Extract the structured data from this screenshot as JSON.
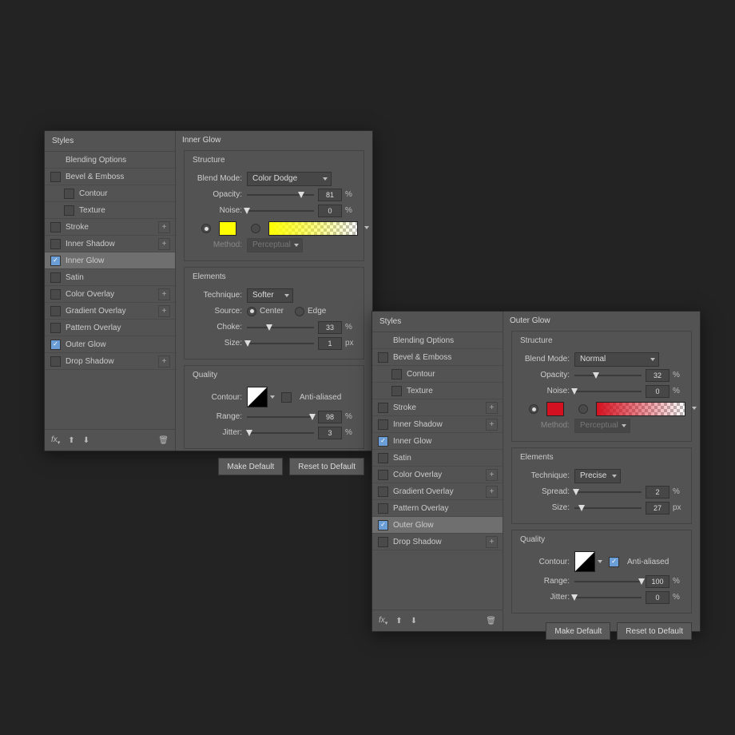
{
  "labels": {
    "styles": "Styles",
    "blending_options": "Blending Options",
    "anti_aliased": "Anti-aliased",
    "make_default": "Make Default",
    "reset_default": "Reset to Default",
    "blend_mode": "Blend Mode:",
    "opacity": "Opacity:",
    "noise": "Noise:",
    "method": "Method:",
    "technique": "Technique:",
    "source": "Source:",
    "center": "Center",
    "edge": "Edge",
    "choke": "Choke:",
    "spread": "Spread:",
    "size": "Size:",
    "contour": "Contour:",
    "range": "Range:",
    "jitter": "Jitter:",
    "structure": "Structure",
    "elements": "Elements",
    "quality": "Quality",
    "pct": "%",
    "px": "px",
    "fx": "fx"
  },
  "style_items": [
    {
      "label": "Bevel & Emboss",
      "plus": false,
      "indent": false,
      "chk": false
    },
    {
      "label": "Contour",
      "plus": false,
      "indent": true,
      "chk": false
    },
    {
      "label": "Texture",
      "plus": false,
      "indent": true,
      "chk": false
    },
    {
      "label": "Stroke",
      "plus": true,
      "indent": false,
      "chk": false
    },
    {
      "label": "Inner Shadow",
      "plus": true,
      "indent": false,
      "chk": false
    },
    {
      "label": "Inner Glow",
      "plus": false,
      "indent": false,
      "chk": true
    },
    {
      "label": "Satin",
      "plus": false,
      "indent": false,
      "chk": false
    },
    {
      "label": "Color Overlay",
      "plus": true,
      "indent": false,
      "chk": false
    },
    {
      "label": "Gradient Overlay",
      "plus": true,
      "indent": false,
      "chk": false
    },
    {
      "label": "Pattern Overlay",
      "plus": false,
      "indent": false,
      "chk": false
    },
    {
      "label": "Outer Glow",
      "plus": false,
      "indent": false,
      "chk": true
    },
    {
      "label": "Drop Shadow",
      "plus": true,
      "indent": false,
      "chk": false
    }
  ],
  "panel1": {
    "title": "Inner Glow",
    "selected_index": 5,
    "blend_mode": "Color Dodge",
    "opacity": 81,
    "noise": 0,
    "solid_color": "#ffff00",
    "grad_from": "#ffff00",
    "grad_to_alpha": true,
    "color_type": "solid",
    "method": "Perceptual",
    "technique": "Softer",
    "source": "center",
    "choke": 33,
    "size": 1,
    "anti_aliased": false,
    "range": 98,
    "jitter": 3
  },
  "panel2": {
    "title": "Outer Glow",
    "selected_index": 10,
    "blend_mode": "Normal",
    "opacity": 32,
    "noise": 0,
    "solid_color": "#d41120",
    "grad_from": "#d41120",
    "grad_to_alpha": true,
    "color_type": "solid",
    "method": "Perceptual",
    "technique": "Precise",
    "spread": 2,
    "size": 27,
    "anti_aliased": true,
    "range": 100,
    "jitter": 0
  }
}
